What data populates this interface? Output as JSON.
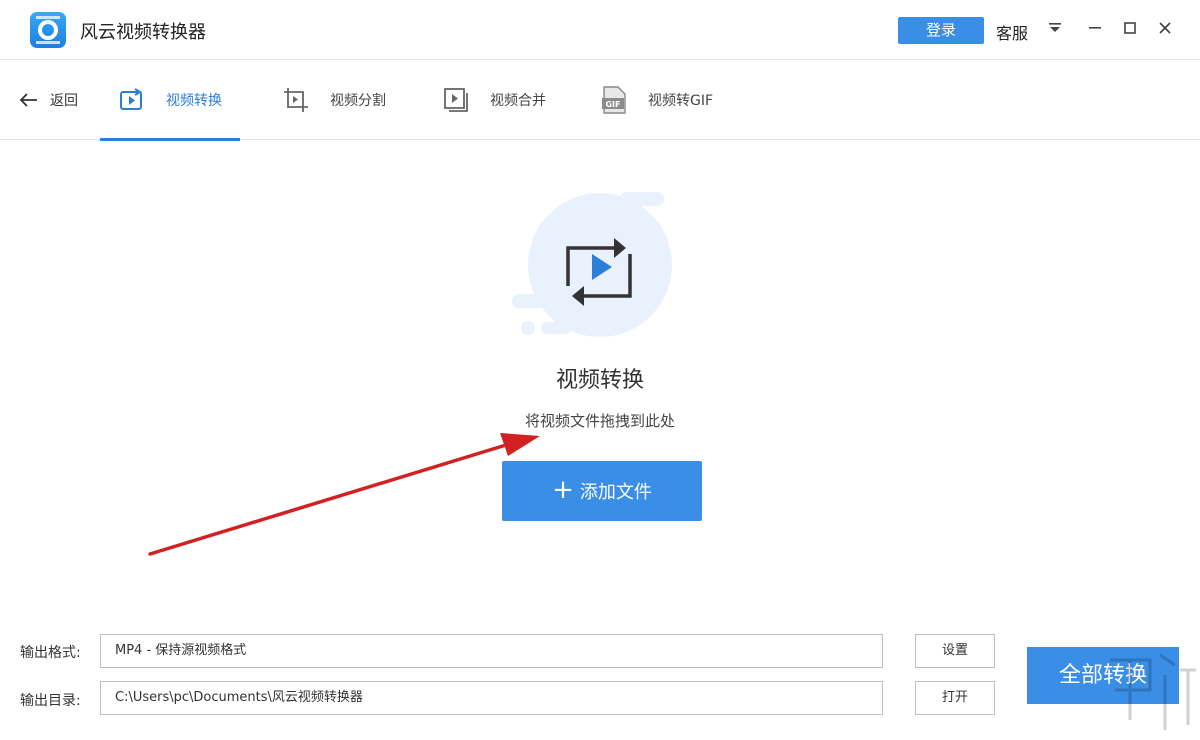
{
  "titlebar": {
    "app_title": "风云视频转换器",
    "login_label": "登录",
    "support_label": "客服"
  },
  "nav": {
    "back_label": "返回",
    "tabs": [
      {
        "label": "视频转换",
        "icon": "convert-icon",
        "active": true
      },
      {
        "label": "视频分割",
        "icon": "crop-icon",
        "active": false
      },
      {
        "label": "视频合并",
        "icon": "merge-icon",
        "active": false
      },
      {
        "label": "视频转GIF",
        "icon": "gif-icon",
        "active": false
      }
    ]
  },
  "dropzone": {
    "title": "视频转换",
    "hint": "将视频文件拖拽到此处",
    "add_button": "添加文件"
  },
  "output": {
    "format_label": "输出格式:",
    "format_value": "MP4 - 保持源视频格式",
    "settings_button": "设置",
    "dir_label": "输出目录:",
    "dir_value": "C:\\Users\\pc\\Documents\\风云视频转换器",
    "open_button": "打开",
    "convert_all_button": "全部转换"
  },
  "colors": {
    "accent": "#3a8ee6",
    "active_tab": "#2d7ed8",
    "annotation_arrow": "#d32020"
  }
}
